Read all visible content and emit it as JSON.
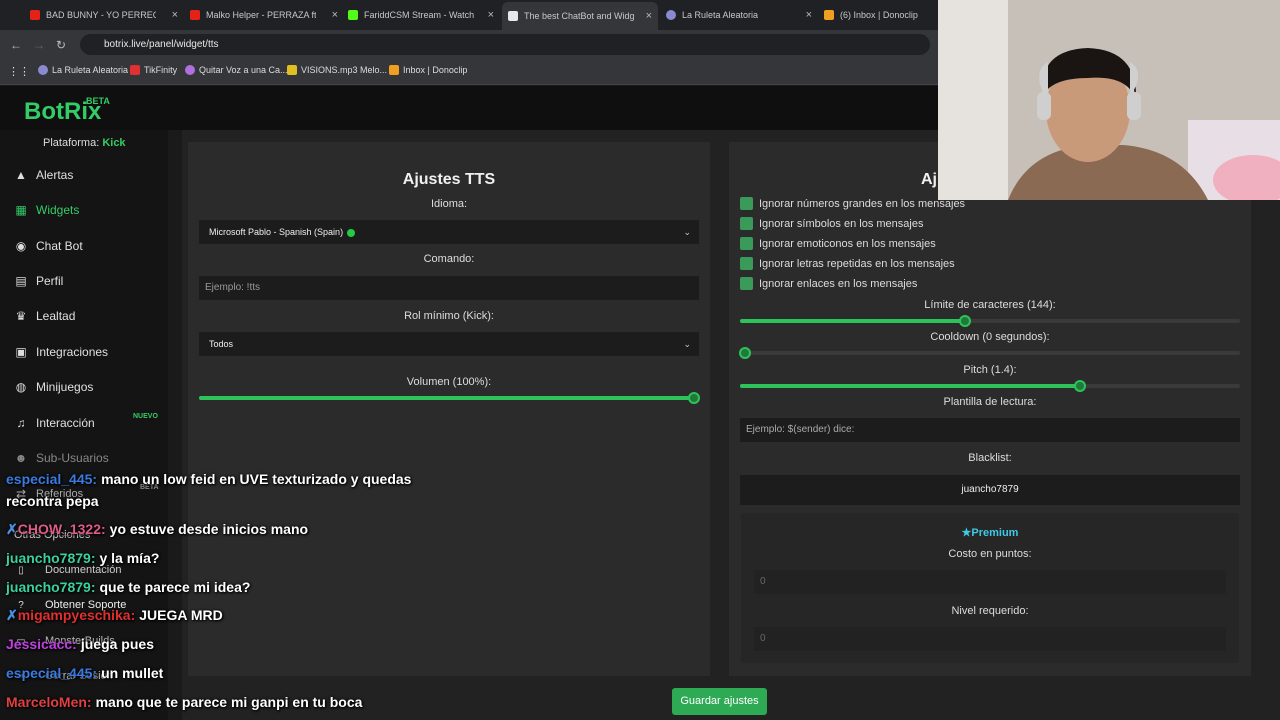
{
  "browser": {
    "tabs": [
      {
        "title": "BAD BUNNY - YO PERREO SOLA",
        "color": "#e62117"
      },
      {
        "title": "Malko Helper - PERRAZA ft. C.C",
        "color": "#e62117"
      },
      {
        "title": "FariddCSM Stream - Watch Live",
        "color": "#53fc18"
      },
      {
        "title": "The best ChatBot and Widgets",
        "color": "#e8e8e8"
      },
      {
        "title": "La Ruleta Aleatoria",
        "color": "#8a8ad0"
      },
      {
        "title": "(6) Inbox | Donoclip",
        "color": "#f0a020"
      }
    ],
    "url": "botrix.live/panel/widget/tts",
    "bookmarks": [
      {
        "label": "La Ruleta Aleatoria",
        "color": "#8a8ad0"
      },
      {
        "label": "TikFinity",
        "color": "#e03030"
      },
      {
        "label": "Quitar Voz a una Ca...",
        "color": "#b070e0"
      },
      {
        "label": "VISIONS.mp3 Melo...",
        "color": "#e0c020"
      },
      {
        "label": "Inbox | Donoclip",
        "color": "#f0a020"
      }
    ]
  },
  "app": {
    "logo": "BotRix",
    "beta": "BETA",
    "platform_label": "Plataforma:",
    "platform_value": "Kick"
  },
  "sidebar": {
    "items": [
      {
        "label": "Alertas",
        "icon": "warning-icon"
      },
      {
        "label": "Widgets",
        "icon": "grid-icon"
      },
      {
        "label": "Chat Bot",
        "icon": "robot-icon"
      },
      {
        "label": "Perfil",
        "icon": "id-card-icon"
      },
      {
        "label": "Lealtad",
        "icon": "trophy-icon"
      },
      {
        "label": "Integraciones",
        "icon": "plug-icon"
      },
      {
        "label": "Minijuegos",
        "icon": "gamepad-icon"
      },
      {
        "label": "Interacción",
        "icon": "music-icon"
      },
      {
        "label": "Sub-Usuarios",
        "icon": "users-icon"
      },
      {
        "label": "Referidos",
        "icon": "share-icon"
      }
    ],
    "nuevo_badge": "NUEVO",
    "beta_badge": "BETA",
    "other_options": "Otras Opciones",
    "links": [
      {
        "label": "Documentación"
      },
      {
        "label": "Obtener Soporte"
      },
      {
        "label": "MonsterBuilds"
      },
      {
        "label": "Cerrar Sesión"
      }
    ]
  },
  "tts_panel": {
    "title": "Ajustes TTS",
    "language_label": "Idioma:",
    "language_value": "Microsoft Pablo - Spanish (Spain)",
    "command_label": "Comando:",
    "command_placeholder": "Ejemplo: !tts",
    "role_label": "Rol mínimo (Kick):",
    "role_value": "Todos",
    "volume_label": "Volumen (100%):",
    "volume_fraction": 1.0
  },
  "right_panel": {
    "title": "Aj",
    "checkboxes": [
      "Ignorar números grandes en los mensajes",
      "Ignorar símbolos en los mensajes",
      "Ignorar emoticonos en los mensajes",
      "Ignorar letras repetidas en los mensajes",
      "Ignorar enlaces en los mensajes"
    ],
    "char_limit_label": "Límite de caracteres (144):",
    "char_limit_fraction": 0.45,
    "cooldown_label": "Cooldown (0 segundos):",
    "cooldown_fraction": 0.0,
    "pitch_label": "Pitch (1.4):",
    "pitch_fraction": 0.68,
    "template_label": "Plantilla de lectura:",
    "template_placeholder": "Ejemplo: $(sender) dice:",
    "blacklist_label": "Blacklist:",
    "blacklist_value": "juancho7879",
    "premium_label": "Premium",
    "cost_label": "Costo en puntos:",
    "cost_value": "0",
    "level_label": "Nivel requerido:",
    "level_value": "0"
  },
  "save_button": "Guardar ajustes",
  "chat": [
    {
      "user": "especial_445:",
      "color": "#3a7be0",
      "text": "mano un low feid en UVE texturizado y quedas"
    },
    {
      "user": "",
      "color": "#ffffff",
      "text": "recontra pepa"
    },
    {
      "user": "CHOW_1322:",
      "color": "#e05a8a",
      "text": "yo estuve desde inicios mano"
    },
    {
      "user": "juancho7879:",
      "color": "#3ad0a0",
      "text": "y la mía?"
    },
    {
      "user": "juancho7879:",
      "color": "#3ad0a0",
      "text": "que te parece mi idea?"
    },
    {
      "user": "migampyeschika:",
      "color": "#e03030",
      "text": "JUEGA MRD"
    },
    {
      "user": "Jessicacc:",
      "color": "#c040e0",
      "text": "juega pues"
    },
    {
      "user": "especial_445:",
      "color": "#3a7be0",
      "text": "un mullet"
    },
    {
      "user": "MarceloMen:",
      "color": "#e04040",
      "text": "mano que te parece mi ganpi en tu boca"
    }
  ]
}
